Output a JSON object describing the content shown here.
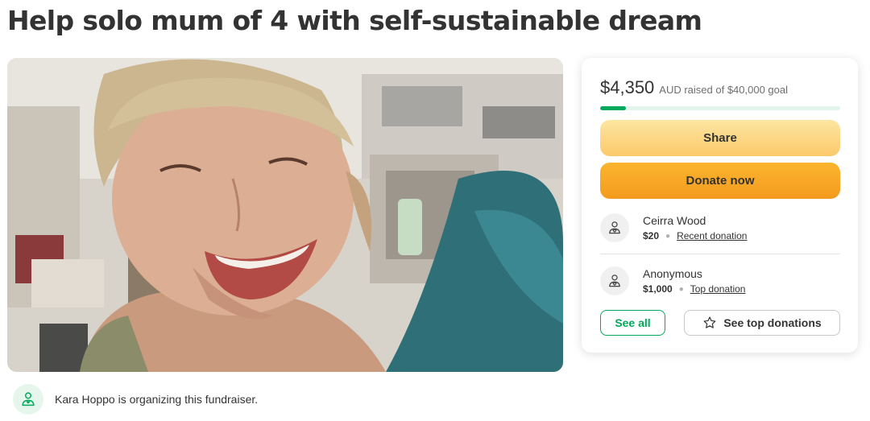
{
  "page": {
    "title": "Help solo mum of 4 with self-sustainable dream"
  },
  "organizer": {
    "text": "Kara Hoppo is organizing this fundraiser.",
    "icon": "user-heart-icon"
  },
  "fundraising": {
    "amount": "$4,350",
    "goal_text": "AUD raised of $40,000 goal",
    "progress_fraction": 0.109
  },
  "buttons": {
    "share": "Share",
    "donate": "Donate now",
    "see_all": "See all",
    "see_top": "See top donations"
  },
  "donations": [
    {
      "name": "Ceirra Wood",
      "amount": "$20",
      "type": "Recent donation",
      "icon": "user-heart-icon"
    },
    {
      "name": "Anonymous",
      "amount": "$1,000",
      "type": "Top donation",
      "icon": "user-heart-icon"
    }
  ],
  "colors": {
    "brand_green": "#02a95c",
    "share_button": "#fbd27e",
    "donate_button": "#f7a825"
  }
}
